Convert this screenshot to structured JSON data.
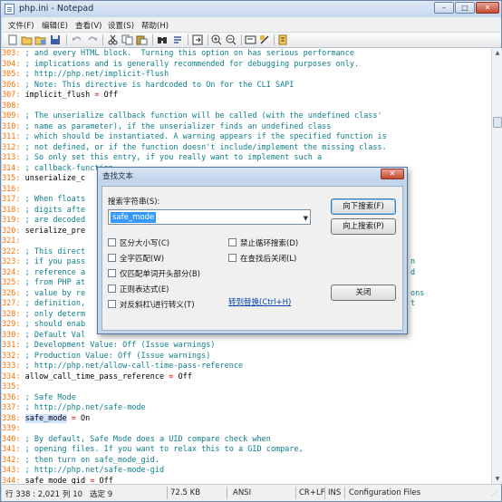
{
  "window": {
    "title": "php.ini - Notepad",
    "min_label": "–",
    "max_label": "□",
    "close_label": "✕"
  },
  "menu": [
    "文件(F)",
    "编辑(E)",
    "查看(V)",
    "设置(S)",
    "帮助(H)"
  ],
  "toolbar_icons": [
    "new-file-icon",
    "open-folder-icon",
    "open-recent-icon",
    "save-icon",
    "undo-icon",
    "redo-icon",
    "cut-icon",
    "copy-icon",
    "paste-icon",
    "find-icon",
    "replace-icon",
    "goto-icon",
    "zoom-in-icon",
    "zoom-out-icon",
    "word-wrap-icon",
    "scheme-icon",
    "options-icon"
  ],
  "editor": {
    "lines": [
      {
        "n": "303",
        "text": "; and every HTML block.  Turning this option on has serious performance",
        "type": "comment"
      },
      {
        "n": "304",
        "text": "; implications and is generally recommended for debugging purposes only.",
        "type": "comment"
      },
      {
        "n": "305",
        "text": "; http://php.net/implicit-flush",
        "type": "comment"
      },
      {
        "n": "306",
        "text": "; Note: This directive is hardcoded to On for the CLI SAPI",
        "type": "comment"
      },
      {
        "n": "307",
        "key": "implicit_flush",
        "eq": "=",
        "value": "Off",
        "type": "kv"
      },
      {
        "n": "308",
        "text": "",
        "type": "blank"
      },
      {
        "n": "309",
        "text": "; The unserialize callback function will be called (with the undefined class'",
        "type": "comment"
      },
      {
        "n": "310",
        "text": "; name as parameter), if the unserializer finds an undefined class",
        "type": "comment"
      },
      {
        "n": "311",
        "text": "; which should be instantiated. A warning appears if the specified function is",
        "type": "comment"
      },
      {
        "n": "312",
        "text": "; not defined, or if the function doesn't include/implement the missing class.",
        "type": "comment"
      },
      {
        "n": "313",
        "text": "; So only set this entry, if you really want to implement such a",
        "type": "comment"
      },
      {
        "n": "314",
        "text": "; callback-function.",
        "type": "comment"
      },
      {
        "n": "315",
        "key": "unserialize_c",
        "eq": "",
        "value": "",
        "type": "kv"
      },
      {
        "n": "316",
        "text": "",
        "type": "blank"
      },
      {
        "n": "317",
        "text": "; When floats",
        "type": "comment"
      },
      {
        "n": "318",
        "text": "; digits afte",
        "type": "comment"
      },
      {
        "n": "319",
        "text": "; are decoded",
        "type": "comment"
      },
      {
        "n": "320",
        "key": "serialize_pre",
        "eq": "",
        "value": "",
        "type": "kv"
      },
      {
        "n": "321",
        "text": "",
        "type": "blank"
      },
      {
        "n": "322",
        "text": "; This direct",
        "type": "comment"
      },
      {
        "n": "323",
        "text": "; if you pass",
        "type": "comment"
      },
      {
        "n": "324",
        "text": "; reference a",
        "type": "comment"
      },
      {
        "n": "325",
        "text": "; from PHP at",
        "type": "comment"
      },
      {
        "n": "326",
        "text": "; value by re",
        "type": "comment"
      },
      {
        "n": "327",
        "text": "; definition,",
        "type": "comment"
      },
      {
        "n": "328",
        "text": "; only determ",
        "type": "comment"
      },
      {
        "n": "329",
        "text": "; should enab",
        "type": "comment"
      },
      {
        "n": "330",
        "text": "; Default Val",
        "type": "comment"
      },
      {
        "n": "331",
        "text": "; Development Value: Off (Issue warnings)",
        "type": "comment"
      },
      {
        "n": "332",
        "text": "; Production Value: Off (Issue warnings)",
        "type": "comment"
      },
      {
        "n": "333",
        "text": "; http://php.net/allow-call-time-pass-reference",
        "type": "comment"
      },
      {
        "n": "334",
        "key": "allow_call_time_pass_reference",
        "eq": "=",
        "value": "Off",
        "type": "kv"
      },
      {
        "n": "335",
        "text": "",
        "type": "blank"
      },
      {
        "n": "336",
        "text": "; Safe Mode",
        "type": "comment"
      },
      {
        "n": "337",
        "text": "; http://php.net/safe-mode",
        "type": "comment"
      },
      {
        "n": "338",
        "key": "safe_mode",
        "eq": "=",
        "value": "On",
        "type": "kv",
        "selected": true
      },
      {
        "n": "339",
        "text": "",
        "type": "blank"
      },
      {
        "n": "340",
        "text": "; By default, Safe Mode does a UID compare check when",
        "type": "comment"
      },
      {
        "n": "341",
        "text": "; opening files. If you want to relax this to a GID compare,",
        "type": "comment"
      },
      {
        "n": "342",
        "text": "; then turn on safe_mode_gid.",
        "type": "comment"
      },
      {
        "n": "343",
        "text": "; http://php.net/safe-mode-gid",
        "type": "comment"
      },
      {
        "n": "344",
        "key": "safe_mode_gid",
        "eq": "=",
        "value": "Off",
        "type": "kv"
      }
    ],
    "right_fragments": [
      {
        "line": "323",
        "text": "n"
      },
      {
        "line": "324",
        "text": "d"
      },
      {
        "line": "326",
        "text": "ons"
      },
      {
        "line": "327",
        "text": "t"
      }
    ]
  },
  "statusbar": {
    "position": "行 338 : 2,021",
    "column": "列 10",
    "selected": "选定 9",
    "size": "72.5 KB",
    "encoding": "ANSI",
    "line_ending": "CR+LF",
    "insert_mode": "INS",
    "file_type": "Configuration Files"
  },
  "find_dialog": {
    "title": "查找文本",
    "close_label": "✕",
    "search_label": "搜索字符串(S):",
    "search_value": "safe_mode",
    "find_next_label": "向下搜索(F)",
    "find_prev_label": "向上搜索(P)",
    "close_button_label": "关闭",
    "options": {
      "match_case": "区分大小写(C)",
      "whole_word": "全字匹配(W)",
      "match_start": "仅匹配单词开头部分(B)",
      "regex": "正则表达式(E)",
      "escape_backslash": "对反斜杠\\进行转义(T)",
      "no_wrap": "禁止循环搜索(D)",
      "close_after_find": "在查找后关闭(L)"
    },
    "replace_link": "转到替换(Ctrl+H)"
  }
}
